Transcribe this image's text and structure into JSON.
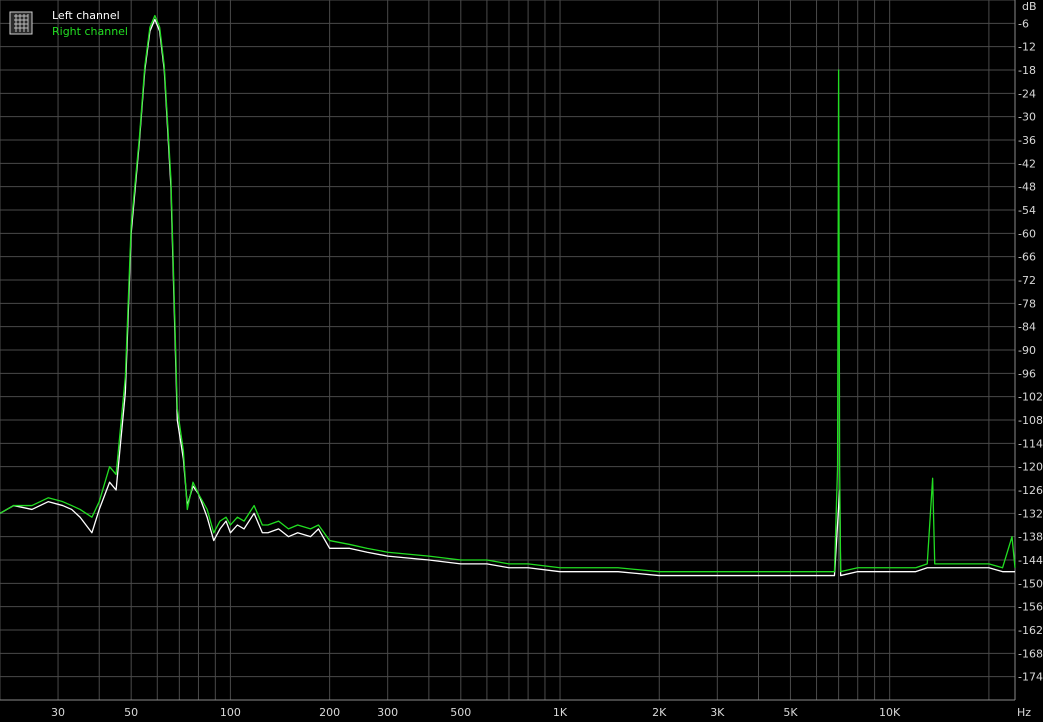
{
  "chart_data": {
    "type": "line",
    "xscale": "log",
    "xlim": [
      20,
      24000
    ],
    "ylim": [
      -180,
      0
    ],
    "grid": true,
    "legend_position": "top-left",
    "ylabel": "dB",
    "xlabel": "Hz",
    "yticks": [
      -6,
      -12,
      -18,
      -24,
      -30,
      -36,
      -42,
      -48,
      -54,
      -60,
      -66,
      -72,
      -78,
      -84,
      -90,
      -96,
      -102,
      -108,
      -114,
      -120,
      -126,
      -132,
      -138,
      -144,
      -150,
      -156,
      -162,
      -168,
      -174
    ],
    "xticks": [
      {
        "value": 30,
        "label": "30"
      },
      {
        "value": 50,
        "label": "50"
      },
      {
        "value": 100,
        "label": "100"
      },
      {
        "value": 200,
        "label": "200"
      },
      {
        "value": 300,
        "label": "300"
      },
      {
        "value": 500,
        "label": "500"
      },
      {
        "value": 1000,
        "label": "1K"
      },
      {
        "value": 2000,
        "label": "2K"
      },
      {
        "value": 3000,
        "label": "3K"
      },
      {
        "value": 5000,
        "label": "5K"
      },
      {
        "value": 10000,
        "label": "10K"
      }
    ],
    "series": [
      {
        "name": "Left channel",
        "color": "#ffffff",
        "points": [
          [
            20,
            -132
          ],
          [
            22,
            -130
          ],
          [
            25,
            -131
          ],
          [
            28,
            -129
          ],
          [
            31,
            -130
          ],
          [
            33,
            -131
          ],
          [
            35,
            -133
          ],
          [
            38,
            -137
          ],
          [
            40,
            -131
          ],
          [
            43,
            -124
          ],
          [
            45,
            -126
          ],
          [
            48,
            -101
          ],
          [
            50,
            -60
          ],
          [
            53,
            -36
          ],
          [
            55,
            -18
          ],
          [
            57,
            -8
          ],
          [
            59,
            -5
          ],
          [
            61,
            -8
          ],
          [
            63,
            -18
          ],
          [
            66,
            -48
          ],
          [
            69,
            -108
          ],
          [
            72,
            -118
          ],
          [
            74,
            -130
          ],
          [
            77,
            -125
          ],
          [
            80,
            -127
          ],
          [
            85,
            -133
          ],
          [
            89,
            -139
          ],
          [
            93,
            -136
          ],
          [
            97,
            -134
          ],
          [
            100,
            -137
          ],
          [
            105,
            -135
          ],
          [
            110,
            -136
          ],
          [
            118,
            -132
          ],
          [
            125,
            -137
          ],
          [
            130,
            -137
          ],
          [
            140,
            -136
          ],
          [
            150,
            -138
          ],
          [
            160,
            -137
          ],
          [
            175,
            -138
          ],
          [
            185,
            -136
          ],
          [
            200,
            -141
          ],
          [
            230,
            -141
          ],
          [
            260,
            -142
          ],
          [
            300,
            -143
          ],
          [
            400,
            -144
          ],
          [
            500,
            -145
          ],
          [
            600,
            -145
          ],
          [
            700,
            -146
          ],
          [
            800,
            -146
          ],
          [
            1000,
            -147
          ],
          [
            1200,
            -147
          ],
          [
            1500,
            -147
          ],
          [
            2000,
            -148
          ],
          [
            2500,
            -148
          ],
          [
            3000,
            -148
          ],
          [
            4000,
            -148
          ],
          [
            5000,
            -148
          ],
          [
            6000,
            -148
          ],
          [
            6800,
            -148
          ],
          [
            7050,
            -126
          ],
          [
            7100,
            -148
          ],
          [
            8000,
            -147
          ],
          [
            9000,
            -147
          ],
          [
            10000,
            -147
          ],
          [
            11000,
            -147
          ],
          [
            12000,
            -147
          ],
          [
            13000,
            -146
          ],
          [
            14000,
            -146
          ],
          [
            15000,
            -146
          ],
          [
            16000,
            -146
          ],
          [
            17000,
            -146
          ],
          [
            18000,
            -146
          ],
          [
            20000,
            -146
          ],
          [
            22000,
            -147
          ],
          [
            24000,
            -147
          ]
        ]
      },
      {
        "name": "Right channel",
        "color": "#22dd22",
        "points": [
          [
            20,
            -132
          ],
          [
            22,
            -130
          ],
          [
            25,
            -130
          ],
          [
            28,
            -128
          ],
          [
            31,
            -129
          ],
          [
            33,
            -130
          ],
          [
            35,
            -131
          ],
          [
            38,
            -133
          ],
          [
            40,
            -129
          ],
          [
            43,
            -120
          ],
          [
            45,
            -122
          ],
          [
            48,
            -97
          ],
          [
            50,
            -58
          ],
          [
            53,
            -35
          ],
          [
            55,
            -17
          ],
          [
            57,
            -7
          ],
          [
            59,
            -4
          ],
          [
            61,
            -7
          ],
          [
            63,
            -17
          ],
          [
            66,
            -46
          ],
          [
            69,
            -105
          ],
          [
            72,
            -116
          ],
          [
            74,
            -131
          ],
          [
            77,
            -124
          ],
          [
            80,
            -127
          ],
          [
            85,
            -131
          ],
          [
            89,
            -137
          ],
          [
            93,
            -134
          ],
          [
            97,
            -133
          ],
          [
            100,
            -135
          ],
          [
            105,
            -133
          ],
          [
            110,
            -134
          ],
          [
            118,
            -130
          ],
          [
            125,
            -135
          ],
          [
            130,
            -135
          ],
          [
            140,
            -134
          ],
          [
            150,
            -136
          ],
          [
            160,
            -135
          ],
          [
            175,
            -136
          ],
          [
            185,
            -135
          ],
          [
            200,
            -139
          ],
          [
            230,
            -140
          ],
          [
            260,
            -141
          ],
          [
            300,
            -142
          ],
          [
            400,
            -143
          ],
          [
            500,
            -144
          ],
          [
            600,
            -144
          ],
          [
            700,
            -145
          ],
          [
            800,
            -145
          ],
          [
            1000,
            -146
          ],
          [
            1200,
            -146
          ],
          [
            1500,
            -146
          ],
          [
            2000,
            -147
          ],
          [
            2500,
            -147
          ],
          [
            3000,
            -147
          ],
          [
            4000,
            -147
          ],
          [
            5000,
            -147
          ],
          [
            6000,
            -147
          ],
          [
            6800,
            -147
          ],
          [
            6950,
            -120
          ],
          [
            7000,
            -18
          ],
          [
            7050,
            -120
          ],
          [
            7100,
            -147
          ],
          [
            8000,
            -146
          ],
          [
            9000,
            -146
          ],
          [
            10000,
            -146
          ],
          [
            11000,
            -146
          ],
          [
            12000,
            -146
          ],
          [
            13000,
            -145
          ],
          [
            13500,
            -123
          ],
          [
            13700,
            -145
          ],
          [
            14000,
            -145
          ],
          [
            15000,
            -145
          ],
          [
            16000,
            -145
          ],
          [
            17000,
            -145
          ],
          [
            18000,
            -145
          ],
          [
            20000,
            -145
          ],
          [
            22000,
            -146
          ],
          [
            23500,
            -138
          ],
          [
            24000,
            -146
          ]
        ]
      }
    ]
  }
}
